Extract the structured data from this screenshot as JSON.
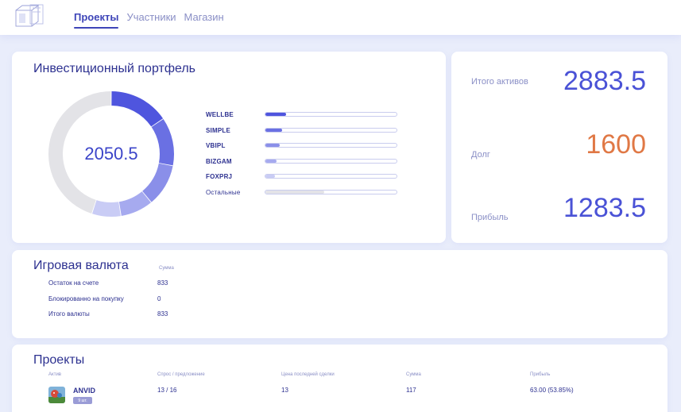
{
  "nav": {
    "items": [
      {
        "label": "Проекты",
        "active": true
      },
      {
        "label": "Участники",
        "active": false
      },
      {
        "label": "Магазин",
        "active": false
      }
    ]
  },
  "portfolio": {
    "title": "Инвестиционный портфель",
    "center_value": "2050.5",
    "segments": [
      {
        "name": "WELLBE",
        "fraction": 0.155,
        "color": "#4f55de"
      },
      {
        "name": "SIMPLE",
        "fraction": 0.125,
        "color": "#6a70e3"
      },
      {
        "name": "VBIPL",
        "fraction": 0.11,
        "color": "#8a8fe9"
      },
      {
        "name": "BIZGAM",
        "fraction": 0.085,
        "color": "#a6aaef"
      },
      {
        "name": "FOXPRJ",
        "fraction": 0.075,
        "color": "#c9ccf5"
      },
      {
        "name": "Остальные",
        "fraction": 0.45,
        "color": "#e3e3e7"
      }
    ]
  },
  "totals": {
    "assets_label": "Итого активов",
    "assets_value": "2883.5",
    "debt_label": "Долг",
    "debt_value": "1600",
    "profit_label": "Прибыль",
    "profit_value": "1283.5"
  },
  "currency": {
    "title": "Игровая валюта",
    "sum_caption": "Сумма",
    "rows": [
      {
        "label": "Остаток на счете",
        "value": "833"
      },
      {
        "label": "Блокированно на покупку",
        "value": "0"
      },
      {
        "label": "Итого валюты",
        "value": "833"
      }
    ]
  },
  "projects": {
    "title": "Проекты",
    "columns": [
      "Актив",
      "Спрос / предложение",
      "Цена последней сделки",
      "Сумма",
      "Прибыль"
    ],
    "rows": [
      {
        "name": "ANVID",
        "badge": "9 шт.",
        "demand_supply": "13 / 16",
        "last_price": "13",
        "sum": "117",
        "profit": "63.00 (53.85%)"
      }
    ]
  }
}
